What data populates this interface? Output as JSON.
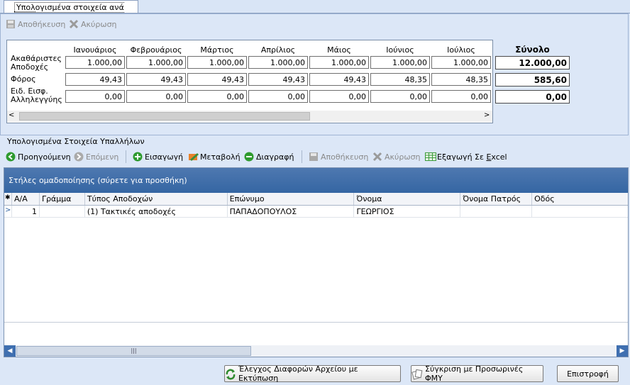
{
  "tab": {
    "label": "Υπολογισμένα στοιχεία ανά μήνα"
  },
  "top_toolbar": {
    "save": "Αποθήκευση",
    "cancel": "Ακύρωση"
  },
  "monthly": {
    "months": [
      "Ιανουάριος",
      "Φεβρουάριος",
      "Μάρτιος",
      "Απρίλιος",
      "Μάιος",
      "Ιούνιος",
      "Ιούλιος"
    ],
    "total_label": "Σύνολο",
    "rows": [
      {
        "label": "Ακαθάριστες Αποδοχές",
        "values": [
          "1.000,00",
          "1.000,00",
          "1.000,00",
          "1.000,00",
          "1.000,00",
          "1.000,00",
          "1.000,00"
        ],
        "total": "12.000,00"
      },
      {
        "label": "Φόρος",
        "values": [
          "49,43",
          "49,43",
          "49,43",
          "49,43",
          "49,43",
          "48,35",
          "48,35"
        ],
        "total": "585,60"
      },
      {
        "label": "Ειδ. Εισφ. Αλληλεγγύης",
        "values": [
          "0,00",
          "0,00",
          "0,00",
          "0,00",
          "0,00",
          "0,00",
          "0,00"
        ],
        "total": "0,00"
      }
    ]
  },
  "section_title": "Υπολογισμένα Στοιχεία Υπαλλήλων",
  "toolbar": {
    "prev": "Προηγούμενη",
    "next": "Επόμενη",
    "insert": "Εισαγωγή",
    "modify": "Μεταβολή",
    "delete": "Διαγραφή",
    "save": "Αποθήκευση",
    "cancel": "Ακύρωση",
    "export_prefix": "Εξαγωγή Σε ",
    "export_accel": "E",
    "export_rest": "xcel"
  },
  "grid": {
    "group_hint": "Στήλες ομαδοποίησης (σύρετε για προσθήκη)",
    "columns": [
      "Α/Α",
      "Γράμμα",
      "Τύπος Αποδοχών",
      "Επώνυμο",
      "Όνομα",
      "Όνομα Πατρός",
      "Οδός"
    ],
    "rows": [
      {
        "aa": "1",
        "letter": "",
        "type": "(1) Τακτικές αποδοχές",
        "surname": "ΠΑΠΑΔΟΠΟΥΛΟΣ",
        "name": "ΓΕΩΡΓΙΟΣ",
        "father": "",
        "street": ""
      }
    ]
  },
  "bottom": {
    "check_diff": "Έλεγχος Διαφορών Αρχείου με Εκτύπωση",
    "compare": "Σύγκριση με Προσωρινές ΦΜΥ",
    "back": "Επιστροφή"
  },
  "colors": {
    "group_header": "#3f6fb0",
    "background": "#dce7f7"
  }
}
